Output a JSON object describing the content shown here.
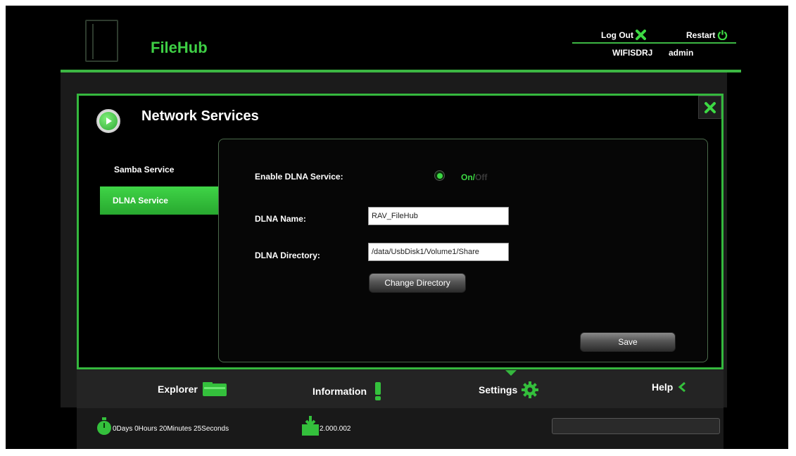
{
  "header": {
    "brand": "FileHub",
    "logout_label": "Log Out",
    "restart_label": "Restart",
    "device_name": "WIFISDRJ",
    "user_name": "admin"
  },
  "panel": {
    "title": "Network Services"
  },
  "sidebar": {
    "items": [
      {
        "label": "Samba Service",
        "active": false
      },
      {
        "label": "DLNA Service",
        "active": true
      }
    ]
  },
  "form": {
    "enable_label": "Enable DLNA Service:",
    "toggle_on": "On",
    "toggle_separator": "/",
    "toggle_off": "Off",
    "enabled": true,
    "name_label": "DLNA Name:",
    "name_value": "RAV_FileHub",
    "directory_label": "DLNA Directory:",
    "directory_value": "/data/UsbDisk1/Volume1/Share",
    "change_directory_label": "Change Directory",
    "save_label": "Save"
  },
  "bottom_nav": {
    "items": [
      {
        "label": "Explorer",
        "icon": "folder-icon"
      },
      {
        "label": "Information",
        "icon": "exclamation-icon"
      },
      {
        "label": "Settings",
        "icon": "gear-icon",
        "active": true
      },
      {
        "label": "Help",
        "icon": "back-arrow-icon"
      }
    ]
  },
  "status": {
    "uptime": "0Days 0Hours 20Minutes 25Seconds",
    "version": "2.000.002",
    "progress": 0
  },
  "colors": {
    "accent": "#3cb643",
    "background": "#000000",
    "panel": "#1b1b1b"
  }
}
